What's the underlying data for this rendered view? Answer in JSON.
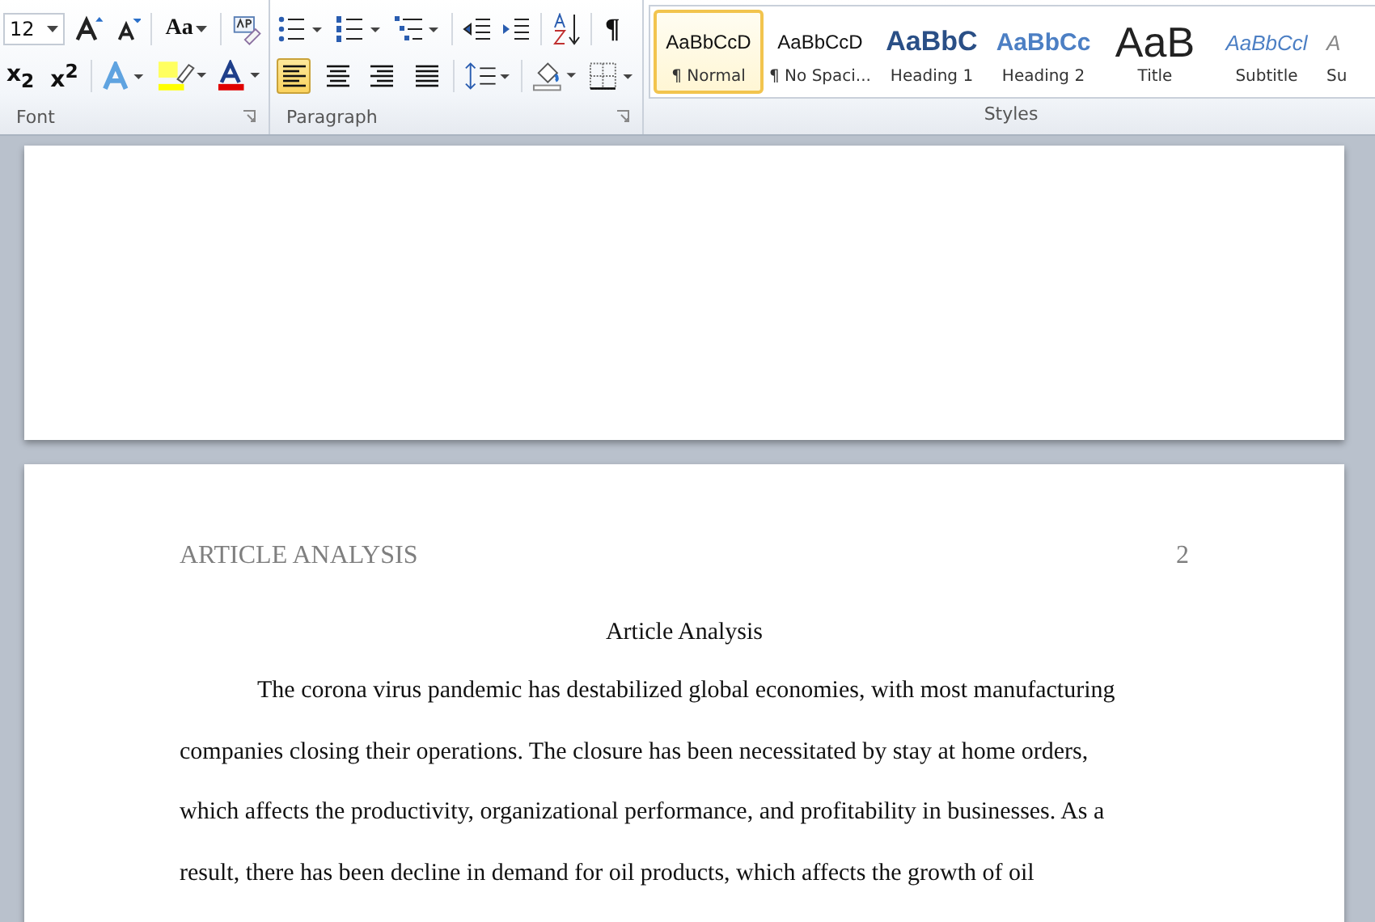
{
  "ribbon": {
    "font_group": {
      "label": "Font",
      "font_size": "12",
      "change_case": "Aa",
      "subscript": "x$_{2}$",
      "superscript": "x$^{2}$"
    },
    "paragraph_group": {
      "label": "Paragraph",
      "pilcrow": "¶",
      "alignments": [
        {
          "kind": "left",
          "selected": true
        },
        {
          "kind": "center",
          "selected": false
        },
        {
          "kind": "right",
          "selected": false
        },
        {
          "kind": "justify",
          "selected": false
        }
      ]
    },
    "styles_group": {
      "label": "Styles",
      "items": [
        {
          "kind": "normal",
          "sample": "AaBbCcD",
          "label": "¶ Normal",
          "selected": true
        },
        {
          "kind": "nospacing",
          "sample": "AaBbCcD",
          "label": "¶ No Spaci...",
          "selected": false
        },
        {
          "kind": "heading1",
          "sample": "AaBbC",
          "label": "Heading 1",
          "selected": false
        },
        {
          "kind": "heading2",
          "sample": "AaBbCc",
          "label": "Heading 2",
          "selected": false
        },
        {
          "kind": "title",
          "sample": "AaB",
          "label": "Title",
          "selected": false
        },
        {
          "kind": "subtitle",
          "sample": "AaBbCcl",
          "label": "Subtitle",
          "selected": false
        },
        {
          "kind": "subtle",
          "sample": "A",
          "label": "Su",
          "selected": false
        }
      ]
    }
  },
  "document": {
    "page": {
      "header": "ARTICLE ANALYSIS",
      "page_number": "2",
      "title": "Article Analysis",
      "paragraph_lines": [
        "The corona virus pandemic has destabilized global economies, with most manufacturing",
        "companies closing their operations. The closure has been necessitated by stay at home orders,",
        "which affects the productivity, organizational performance, and profitability in businesses.  As a",
        "result, there has been decline in demand for oil products, which affects the growth of oil"
      ]
    }
  }
}
